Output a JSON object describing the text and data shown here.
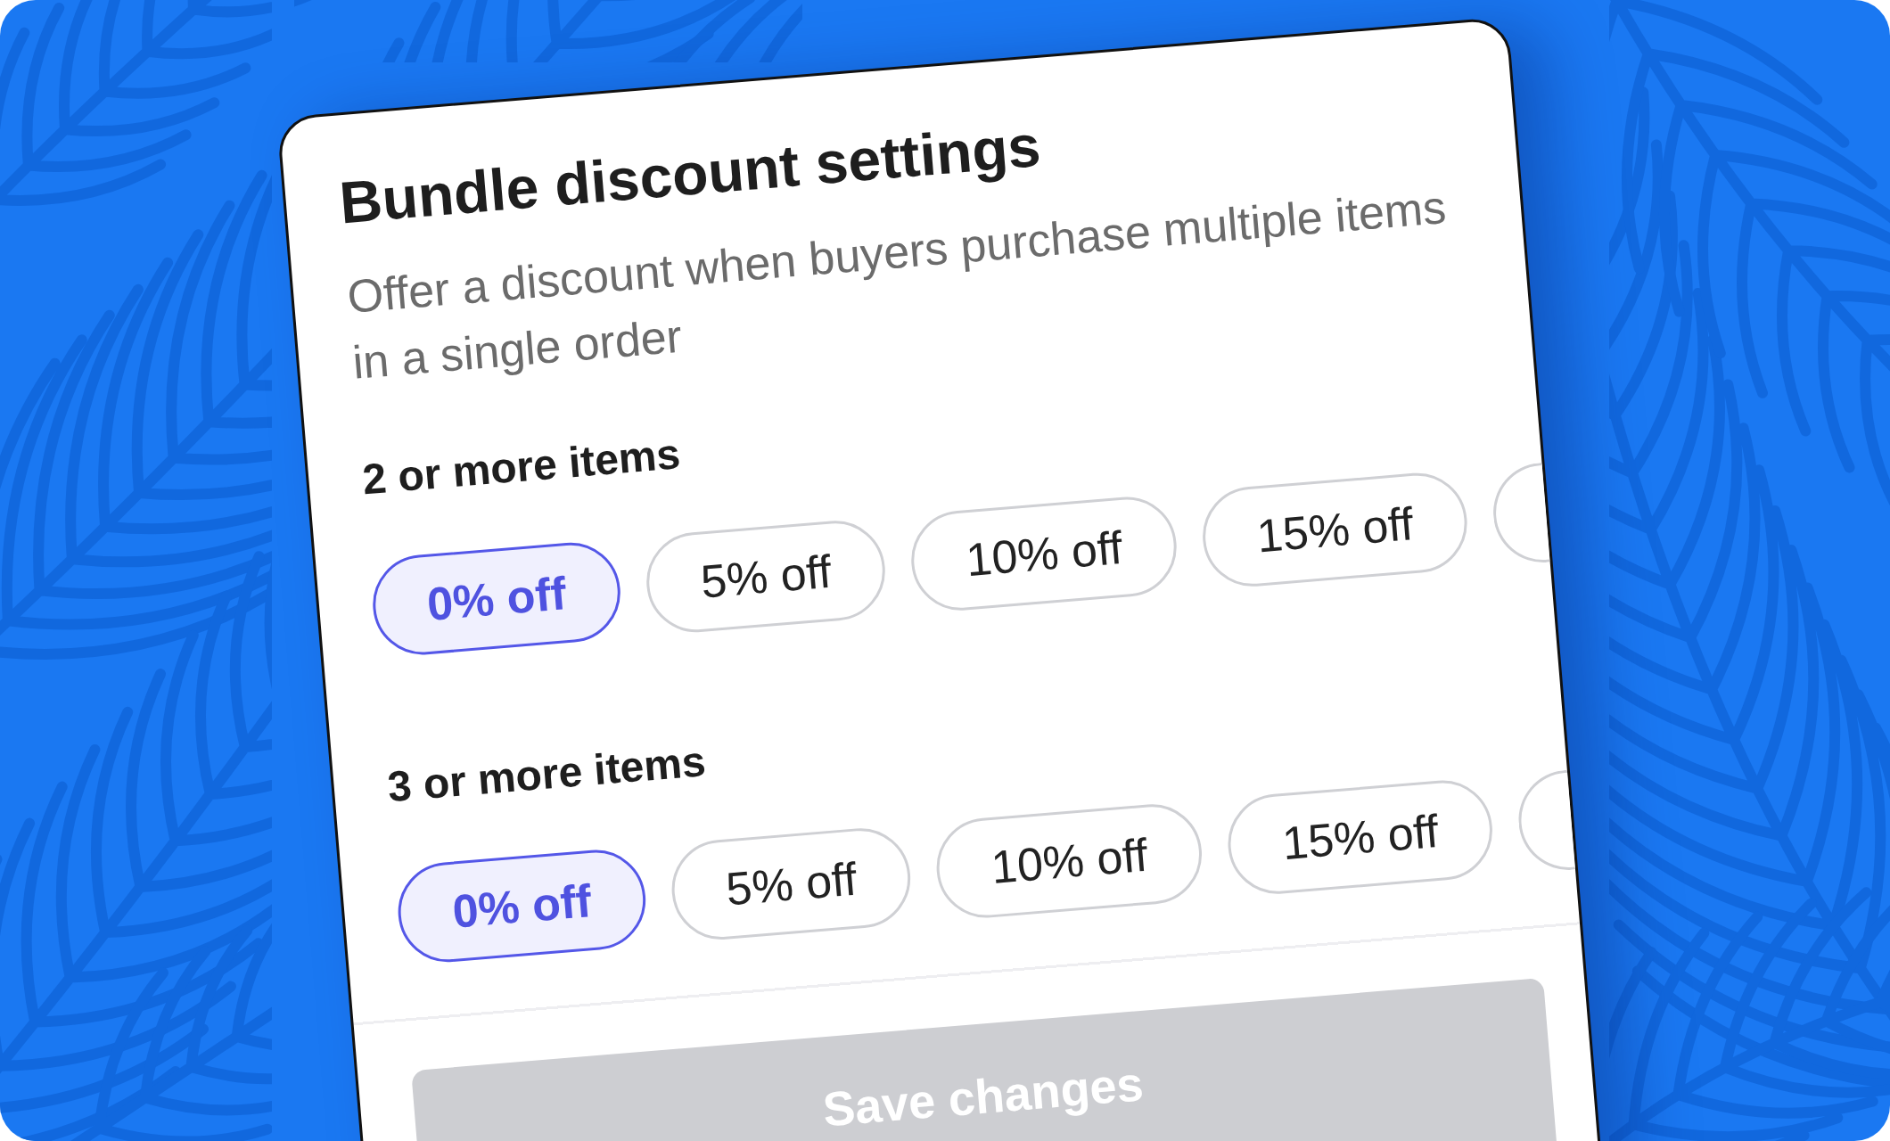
{
  "card": {
    "title": "Bundle discount settings",
    "subtitle": "Offer a discount when buyers purchase multiple items in a single order",
    "tiers": [
      {
        "label": "2 or more items",
        "options": [
          {
            "label": "0% off",
            "selected": true
          },
          {
            "label": "5% off",
            "selected": false
          },
          {
            "label": "10% off",
            "selected": false
          },
          {
            "label": "15% off",
            "selected": false
          },
          {
            "selected": false
          }
        ]
      },
      {
        "label": "3 or more items",
        "options": [
          {
            "label": "0% off",
            "selected": true
          },
          {
            "label": "5% off",
            "selected": false
          },
          {
            "label": "10% off",
            "selected": false
          },
          {
            "label": "15% off",
            "selected": false
          },
          {
            "selected": false
          }
        ]
      }
    ],
    "save_button": {
      "label": "Save changes",
      "disabled": true
    }
  }
}
